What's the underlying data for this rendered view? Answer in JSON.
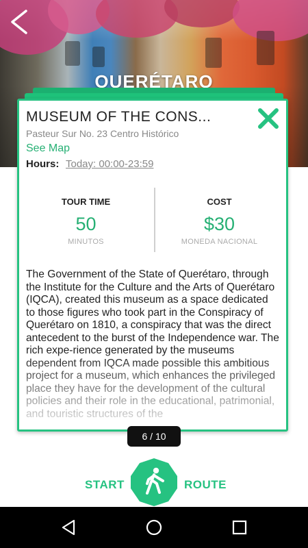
{
  "header": {
    "city": "QUERÉTARO",
    "back_icon": "chevron-left-icon"
  },
  "card": {
    "title": "MUSEUM OF THE CONS...",
    "address": "Pasteur Sur No. 23 Centro Histórico",
    "see_map": "See Map",
    "hours_label": "Hours:",
    "hours_value": "Today: 00:00-23:59",
    "close_icon": "close-icon",
    "stats": {
      "tour_time_label": "TOUR TIME",
      "tour_time_value": "50",
      "tour_time_unit": "MINUTOS",
      "cost_label": "COST",
      "cost_value": "$30",
      "cost_unit": "MONEDA NACIONAL"
    },
    "description": "The Government of the State of Querétaro, through the Institute for the Culture and the Arts of Querétaro (IQCA), created this museum as a space dedicated to those figures who took part in the Conspiracy of Querétaro on 1810, a conspiracy that was the direct antecedent to the burst of the Independence war. The rich expe-rience generated by the museums dependent from IQCA made possible this ambitious project for a museum, which enhances the privileged place they have for the development of the cultural policies and their role in the educational, patrimonial, and touristic structures of the"
  },
  "pager": {
    "text": "6 / 10"
  },
  "route": {
    "start_label": "START",
    "end_label": "ROUTE",
    "icon": "walking-person-icon"
  },
  "colors": {
    "accent": "#26c281",
    "pager_bg": "#111111",
    "navbar_bg": "#000000"
  },
  "navbar": {
    "back_icon": "nav-back-icon",
    "home_icon": "nav-home-icon",
    "recents_icon": "nav-recents-icon"
  }
}
